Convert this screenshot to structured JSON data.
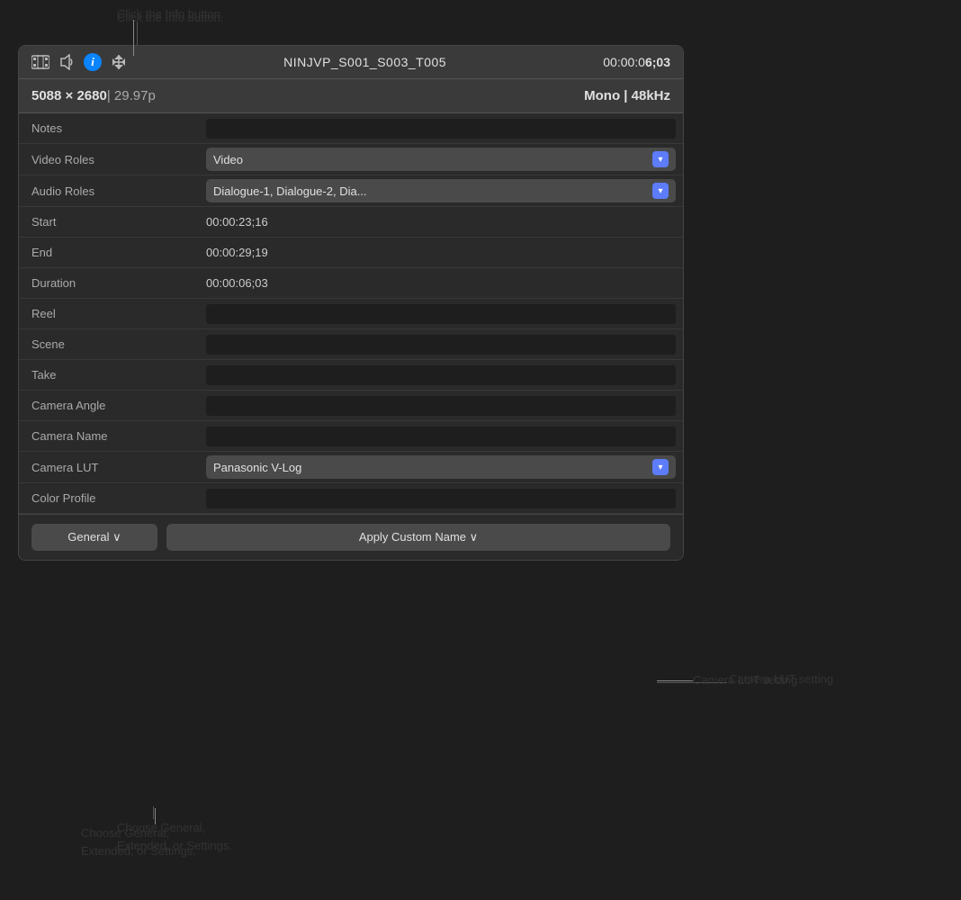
{
  "annotations": {
    "info_button_label": "Click the Info button.",
    "camera_lut_label": "Camera LUT setting",
    "general_label": "Choose General,\nExtended, or Settings."
  },
  "toolbar": {
    "title": "NINJVP_S001_S003_T005",
    "timecode": "00:00:0",
    "timecode2": "6;03"
  },
  "info_bar": {
    "resolution": "5088 × 2680",
    "fps": "| 29.97p",
    "audio": "Mono | 48kHz"
  },
  "properties": [
    {
      "label": "Notes",
      "type": "input",
      "value": ""
    },
    {
      "label": "Video Roles",
      "type": "dropdown",
      "value": "Video"
    },
    {
      "label": "Audio Roles",
      "type": "dropdown",
      "value": "Dialogue-1, Dialogue-2, Dia..."
    },
    {
      "label": "Start",
      "type": "text",
      "value": "00:00:23;16"
    },
    {
      "label": "End",
      "type": "text",
      "value": "00:00:29;19"
    },
    {
      "label": "Duration",
      "type": "text",
      "value": "00:00:06;03"
    },
    {
      "label": "Reel",
      "type": "input",
      "value": ""
    },
    {
      "label": "Scene",
      "type": "input",
      "value": ""
    },
    {
      "label": "Take",
      "type": "input",
      "value": ""
    },
    {
      "label": "Camera Angle",
      "type": "input",
      "value": ""
    },
    {
      "label": "Camera Name",
      "type": "input",
      "value": ""
    },
    {
      "label": "Camera LUT",
      "type": "dropdown",
      "value": "Panasonic V-Log"
    },
    {
      "label": "Color Profile",
      "type": "input",
      "value": ""
    }
  ],
  "footer": {
    "general_btn": "General ∨",
    "apply_btn": "Apply Custom Name ∨"
  },
  "icons": {
    "film": "▤",
    "audio": "◉",
    "info": "i",
    "transform": "⇕",
    "chevron_down": "▾"
  }
}
